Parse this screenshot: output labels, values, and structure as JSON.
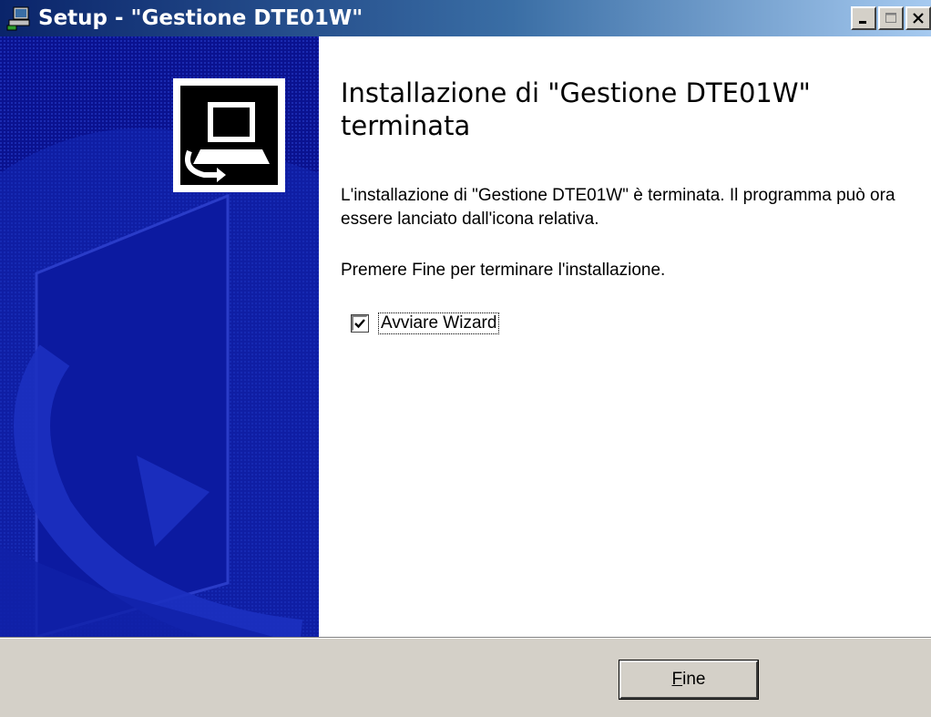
{
  "window": {
    "title": "Setup - \"Gestione DTE01W\"",
    "app_icon": "setup-computer-icon",
    "controls": [
      "minimize-icon",
      "maximize-icon",
      "close-icon"
    ]
  },
  "wizard": {
    "heading": "Installazione di \"Gestione DTE01W\" terminata",
    "paragraph1": "L'installazione di \"Gestione DTE01W\" è terminata. Il programma può ora essere lanciato dall'icona relativa.",
    "paragraph2": "Premere Fine per terminare l'installazione.",
    "checkbox": {
      "label": "Avviare Wizard",
      "checked": true
    },
    "side_image": "computer-install-icon"
  },
  "footer": {
    "finish_button": {
      "accel": "F",
      "rest": "ine"
    }
  },
  "colors": {
    "title_gradient_start": "#0a246a",
    "title_gradient_end": "#a6caf0",
    "side_panel": "#08108c",
    "face": "#d4d0c8"
  }
}
